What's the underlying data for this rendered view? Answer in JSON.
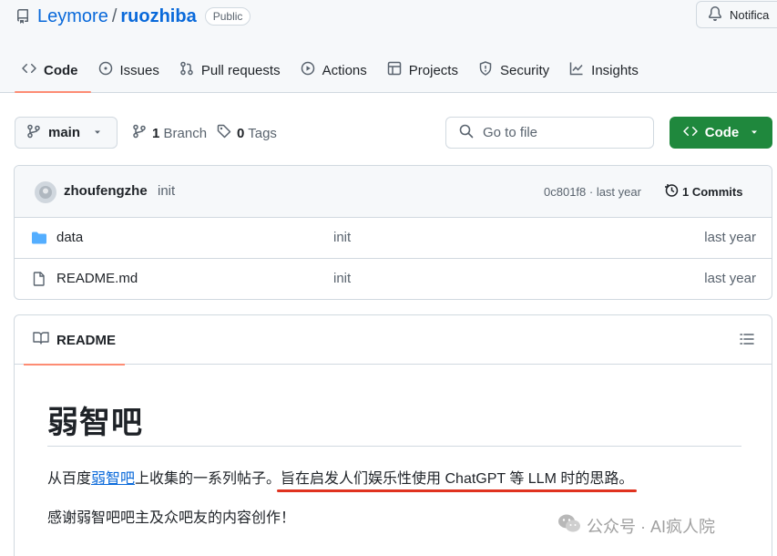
{
  "repo": {
    "owner": "Leymore",
    "separator": "/",
    "name": "ruozhiba",
    "visibility": "Public"
  },
  "header": {
    "notifications_label": "Notifica"
  },
  "tabs": [
    {
      "label": "Code",
      "icon": "code-icon"
    },
    {
      "label": "Issues",
      "icon": "issue-icon"
    },
    {
      "label": "Pull requests",
      "icon": "pull-request-icon"
    },
    {
      "label": "Actions",
      "icon": "play-icon"
    },
    {
      "label": "Projects",
      "icon": "table-icon"
    },
    {
      "label": "Security",
      "icon": "shield-icon"
    },
    {
      "label": "Insights",
      "icon": "graph-icon"
    }
  ],
  "toolbar": {
    "branch": "main",
    "branch_count": "1",
    "branch_label": "Branch",
    "tag_count": "0",
    "tag_label": "Tags",
    "goto_placeholder": "Go to file",
    "code_button": "Code"
  },
  "latest_commit": {
    "author": "zhoufengzhe",
    "message": "init",
    "hash_time": "0c801f8 · last year",
    "commits": "1 Commits"
  },
  "files": [
    {
      "type": "folder",
      "name": "data",
      "message": "init",
      "time": "last year"
    },
    {
      "type": "file",
      "name": "README.md",
      "message": "init",
      "time": "last year"
    }
  ],
  "readme": {
    "tab_label": "README",
    "heading": "弱智吧",
    "p1_prefix": "从百度",
    "p1_link": "弱智吧",
    "p1_middle": "上收集的一系列帖子。",
    "p1_highlight": "旨在启发人们娱乐性使用 ChatGPT 等 LLM 时的思路。",
    "p2": "感谢弱智吧吧主及众吧友的内容创作！"
  },
  "watermark": "公众号 · AI疯人院",
  "colors": {
    "accent_link": "#0969da",
    "code_button": "#1f883d",
    "tab_underline": "#fd8c73",
    "highlight_underline": "#e0321f"
  }
}
